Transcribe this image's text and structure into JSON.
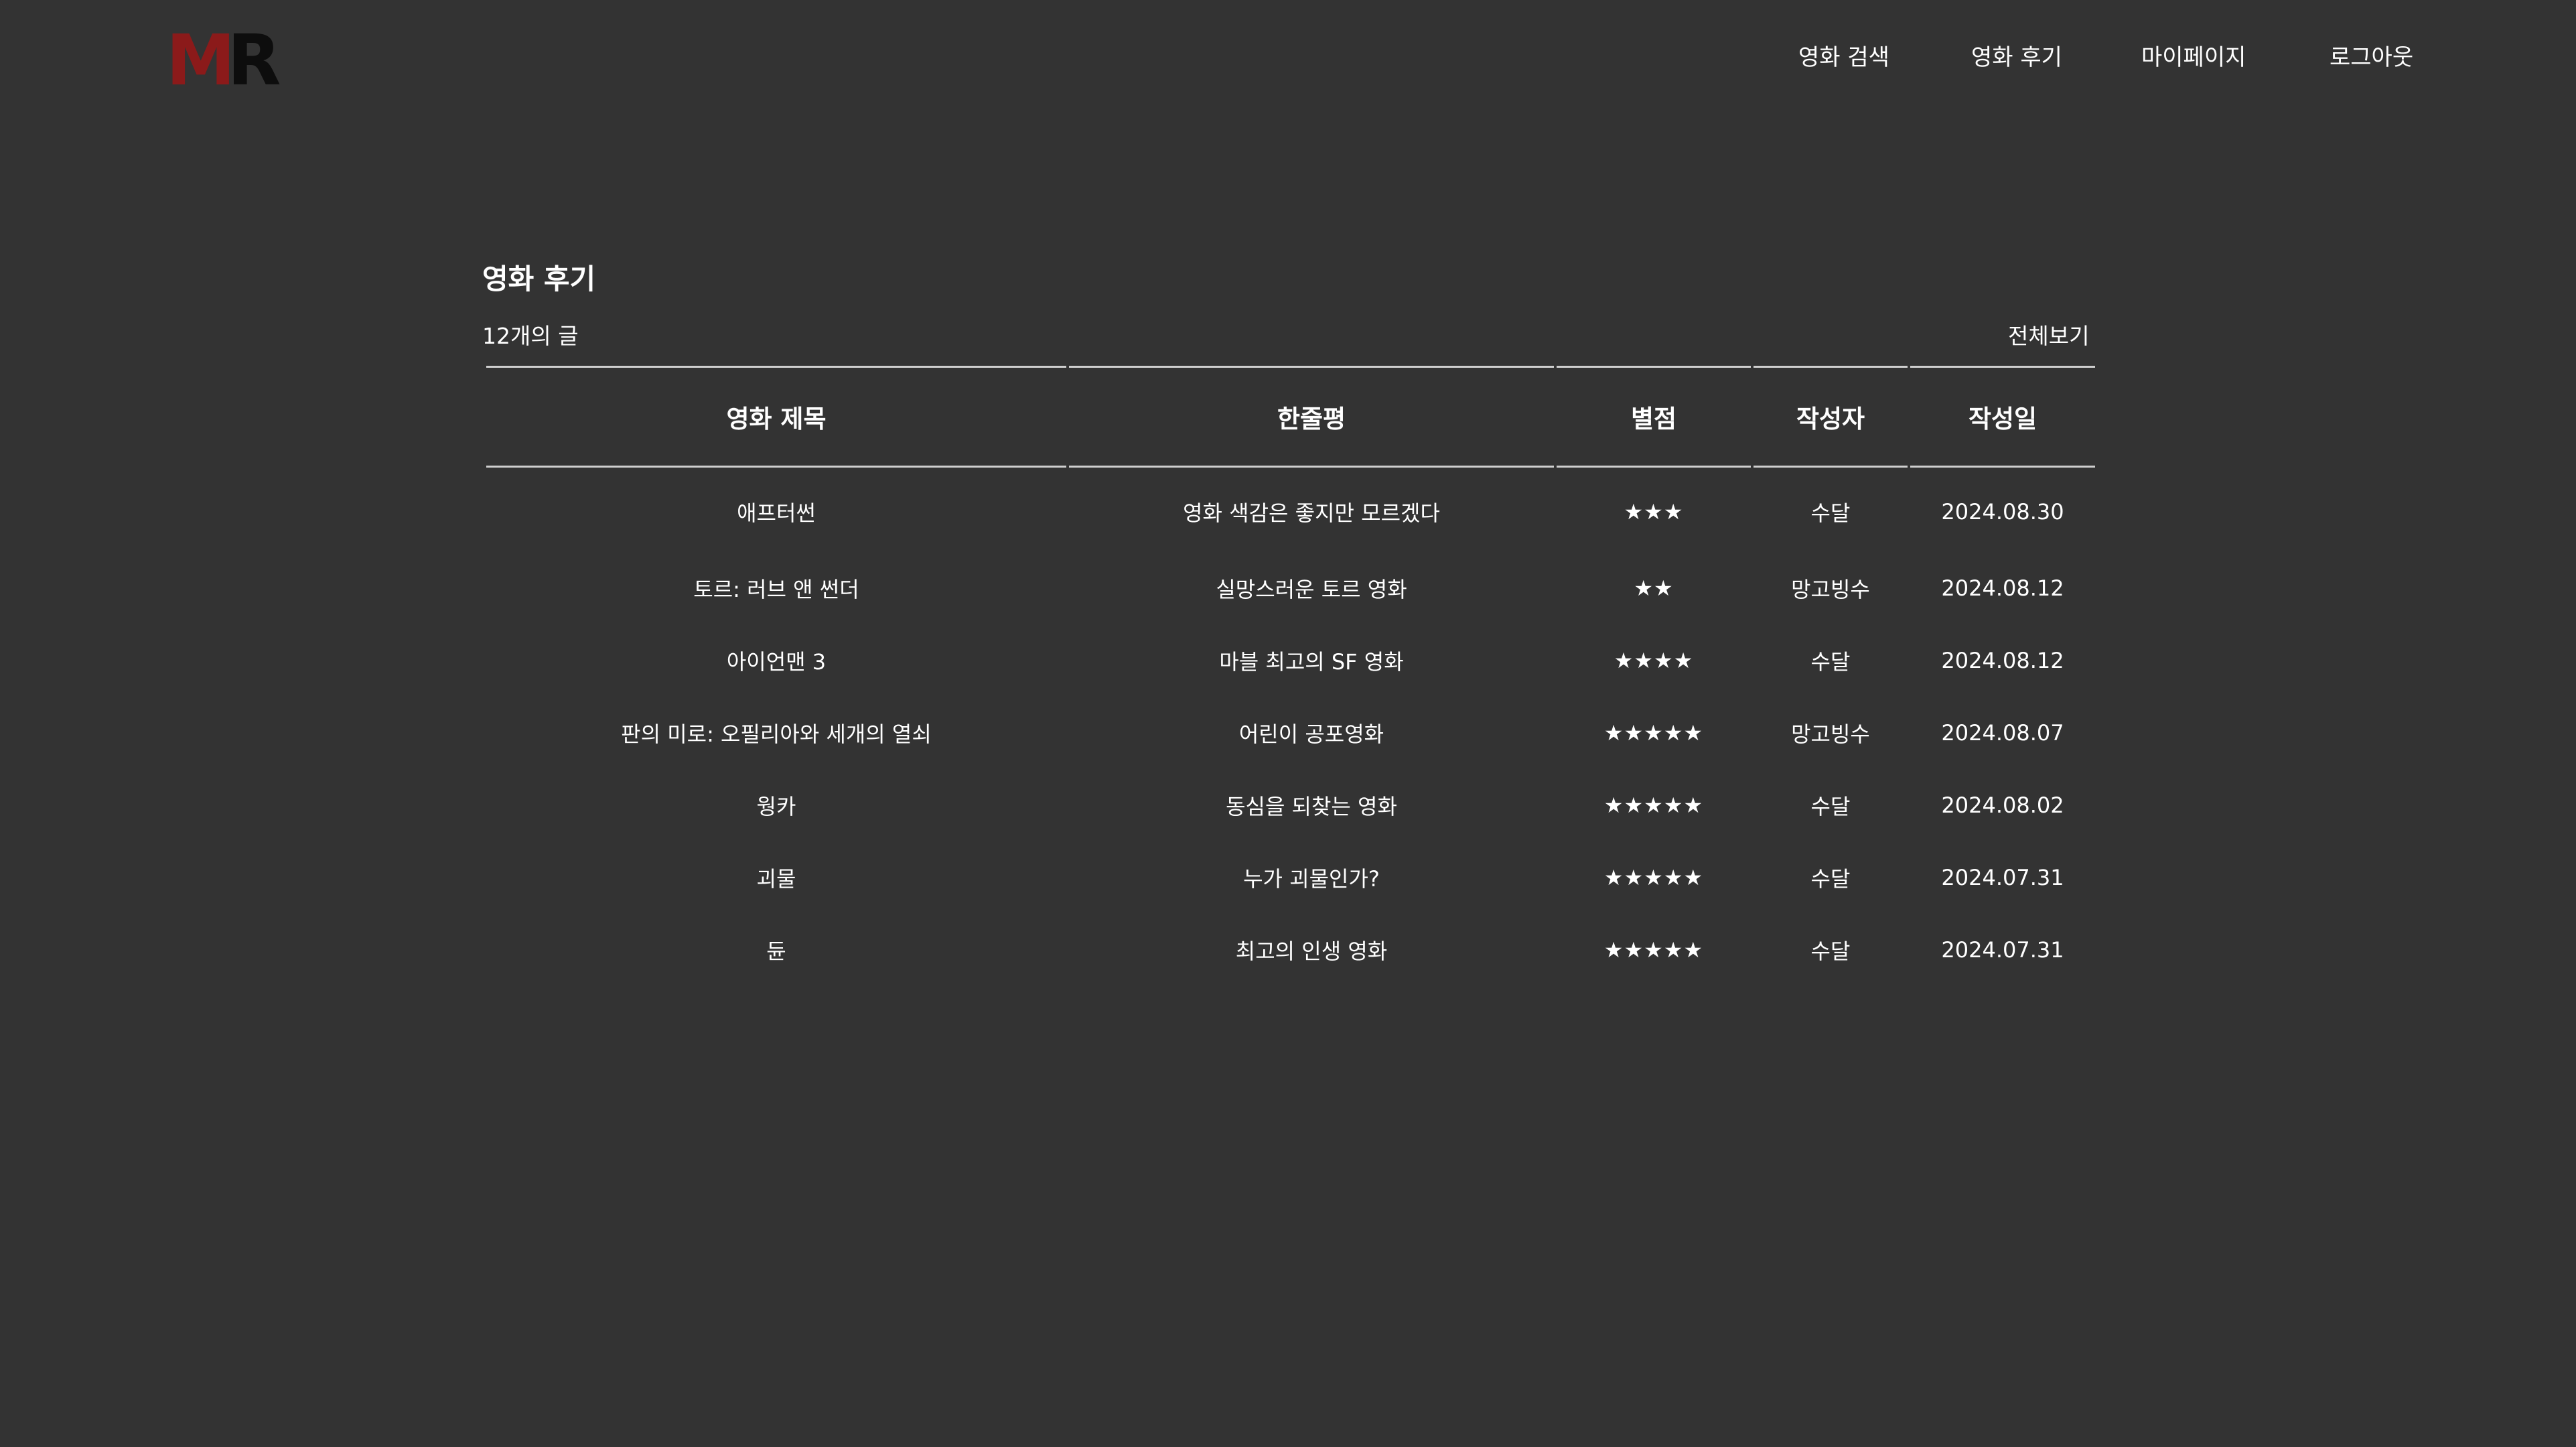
{
  "logo": {
    "m": "M",
    "r": "R"
  },
  "nav": {
    "search": "영화 검색",
    "reviews": "영화 후기",
    "mypage": "마이페이지",
    "logout": "로그아웃"
  },
  "section": {
    "title": "영화 후기",
    "count": "12개의 글",
    "view_all": "전체보기"
  },
  "table": {
    "headers": [
      "영화 제목",
      "한줄평",
      "별점",
      "작성자",
      "작성일"
    ],
    "rows": [
      {
        "title": "애프터썬",
        "comment": "영화 색감은 좋지만 모르겠다",
        "stars": "★★★",
        "author": "수달",
        "date": "2024.08.30"
      },
      {
        "title": "토르: 러브 앤 썬더",
        "comment": "실망스러운 토르 영화",
        "stars": "★★",
        "author": "망고빙수",
        "date": "2024.08.12"
      },
      {
        "title": "아이언맨 3",
        "comment": "마블 최고의 SF 영화",
        "stars": "★★★★",
        "author": "수달",
        "date": "2024.08.12"
      },
      {
        "title": "판의 미로: 오필리아와 세개의 열쇠",
        "comment": "어린이 공포영화",
        "stars": "★★★★★",
        "author": "망고빙수",
        "date": "2024.08.07"
      },
      {
        "title": "웡카",
        "comment": "동심을 되찾는 영화",
        "stars": "★★★★★",
        "author": "수달",
        "date": "2024.08.02"
      },
      {
        "title": "괴물",
        "comment": "누가 괴물인가?",
        "stars": "★★★★★",
        "author": "수달",
        "date": "2024.07.31"
      },
      {
        "title": "듄",
        "comment": "최고의 인생 영화",
        "stars": "★★★★★",
        "author": "수달",
        "date": "2024.07.31"
      }
    ]
  }
}
